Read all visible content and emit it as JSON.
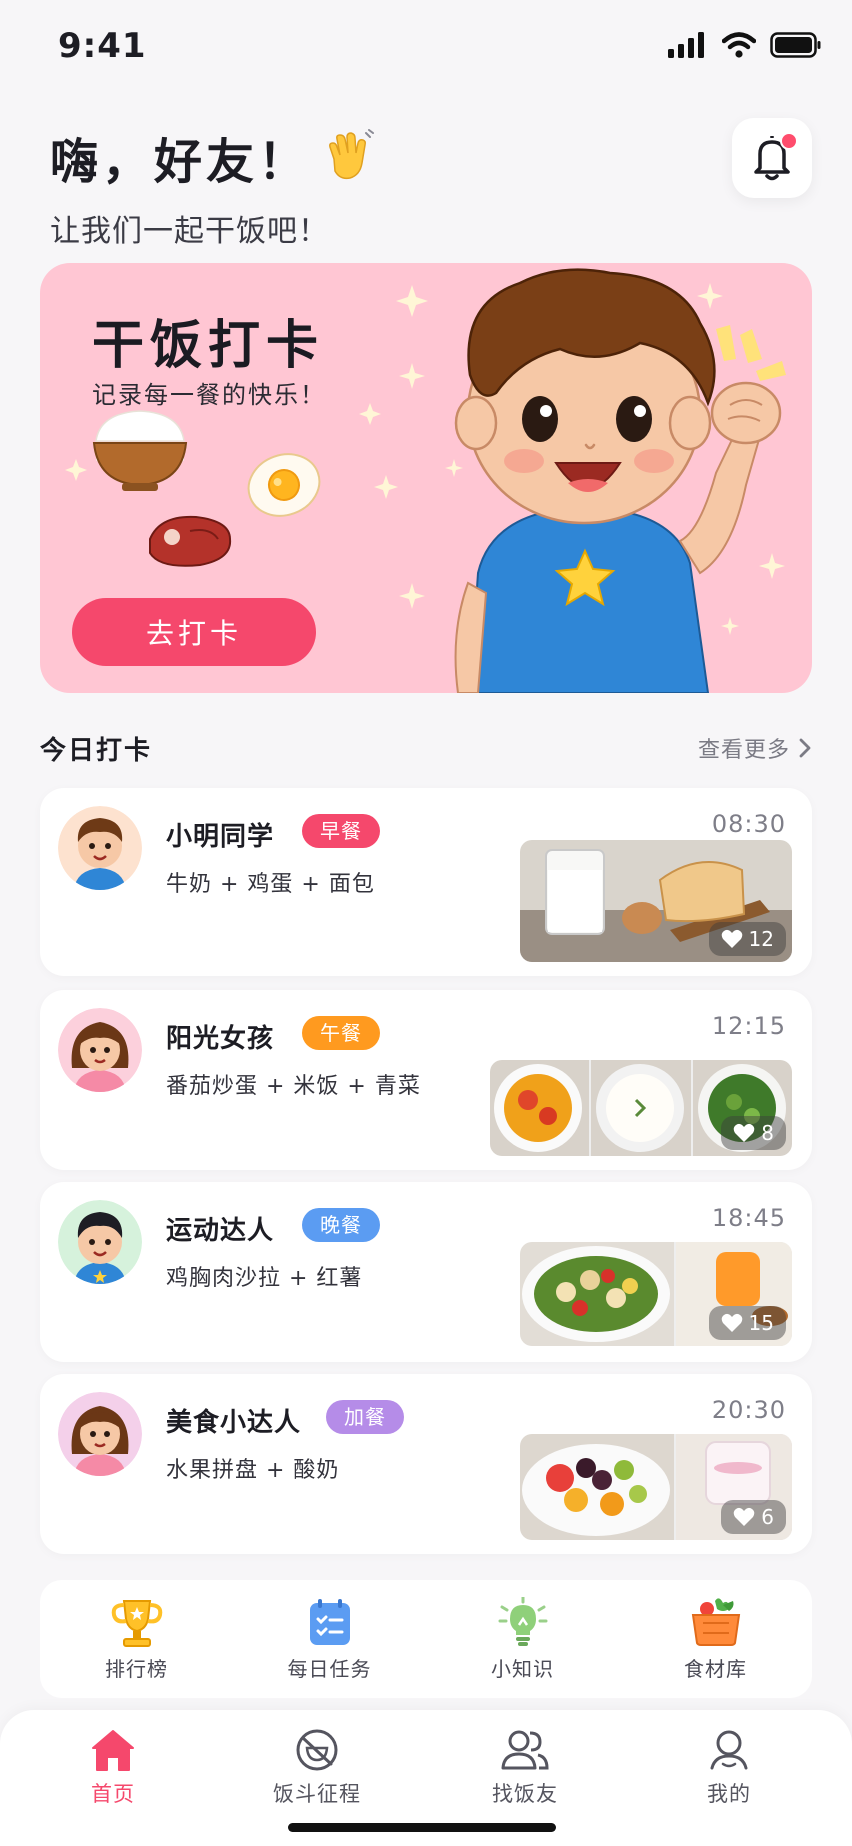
{
  "status": {
    "time": "9:41"
  },
  "greeting": {
    "title": "嗨，好友！",
    "subtitle": "让我们一起干饭吧！"
  },
  "banner": {
    "title": "干饭打卡",
    "subtitle": "记录每一餐的快乐！",
    "button": "去打卡"
  },
  "section": {
    "title": "今日打卡",
    "more": "查看更多"
  },
  "checkins": [
    {
      "name": "小明同学",
      "tag": "早餐",
      "tag_color": "#f5486c",
      "food": "牛奶 + 鸡蛋 + 面包",
      "time": "08:30",
      "likes": "12"
    },
    {
      "name": "阳光女孩",
      "tag": "午餐",
      "tag_color": "#ff9a1f",
      "food": "番茄炒蛋 + 米饭 + 青菜",
      "time": "12:15",
      "likes": "8"
    },
    {
      "name": "运动达人",
      "tag": "晚餐",
      "tag_color": "#5b9cf2",
      "food": "鸡胸肉沙拉 + 红薯",
      "time": "18:45",
      "likes": "15"
    },
    {
      "name": "美食小达人",
      "tag": "加餐",
      "tag_color": "#b58ce8",
      "food": "水果拼盘 + 酸奶",
      "time": "20:30",
      "likes": "6"
    }
  ],
  "quick": [
    {
      "label": "排行榜",
      "icon": "trophy-icon"
    },
    {
      "label": "每日任务",
      "icon": "task-list-icon"
    },
    {
      "label": "小知识",
      "icon": "lightbulb-icon"
    },
    {
      "label": "食材库",
      "icon": "vegetable-basket-icon"
    }
  ],
  "tabs": [
    {
      "label": "首页",
      "icon": "home-icon"
    },
    {
      "label": "饭斗征程",
      "icon": "bowl-journey-icon"
    },
    {
      "label": "找饭友",
      "icon": "friends-icon"
    },
    {
      "label": "我的",
      "icon": "profile-icon"
    }
  ],
  "colors": {
    "accent": "#f5486c",
    "banner_bg": "#ffc6d3"
  }
}
